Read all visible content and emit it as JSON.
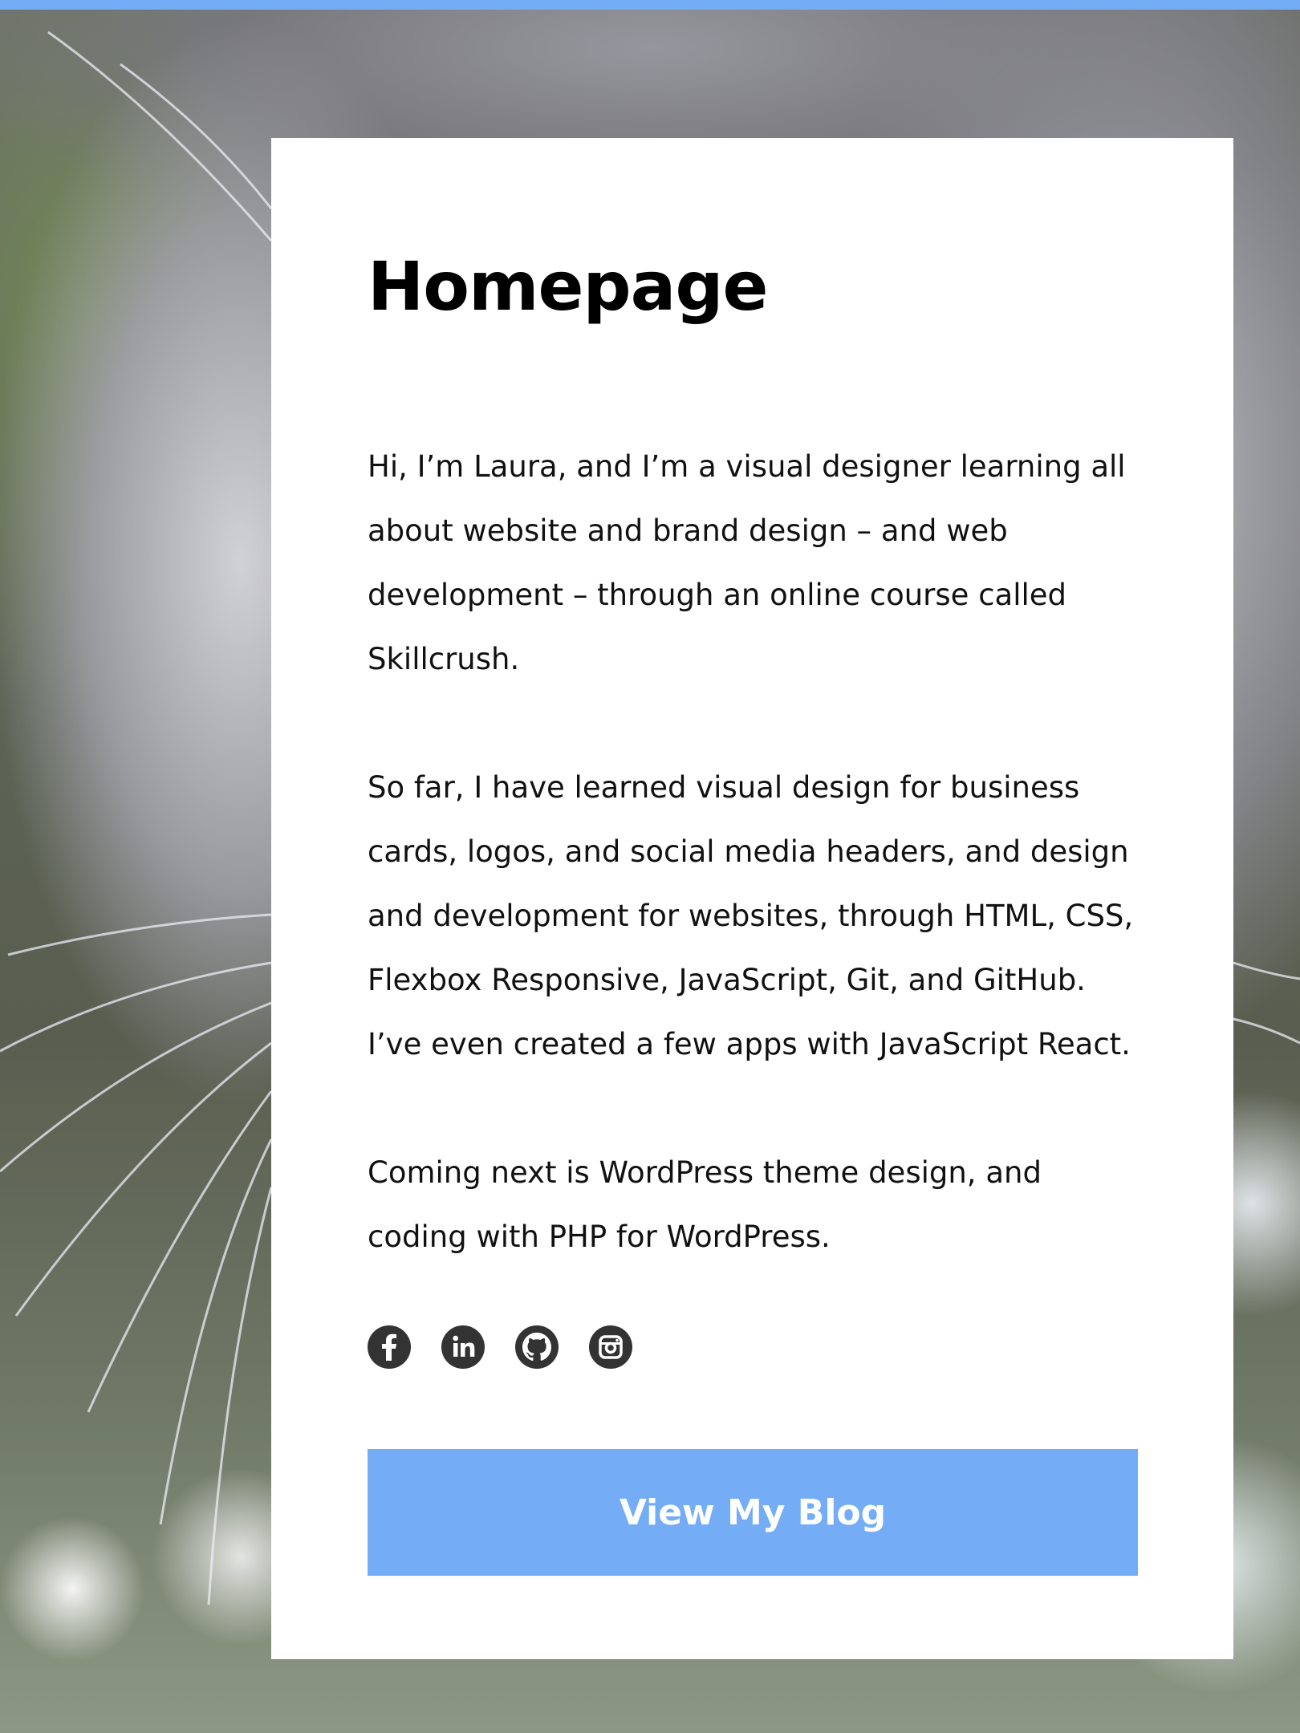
{
  "page": {
    "title": "Homepage",
    "accent_color": "#74adf5"
  },
  "intro": {
    "paragraphs": [
      "Hi, I’m Laura, and I’m a visual designer learning all about website and brand design – and web development – through an online course called Skillcrush.",
      "So far, I have learned visual design for business cards, logos, and social media headers, and design and development for websites, through HTML, CSS, Flexbox Responsive, JavaScript, Git, and GitHub. I’ve even created a few apps with JavaScript React.",
      "Coming next is WordPress theme design, and coding with PHP for WordPress."
    ]
  },
  "socials": [
    {
      "icon": "facebook-icon"
    },
    {
      "icon": "linkedin-icon"
    },
    {
      "icon": "github-icon"
    },
    {
      "icon": "instagram-icon"
    }
  ],
  "cta": {
    "label": "View My Blog"
  }
}
